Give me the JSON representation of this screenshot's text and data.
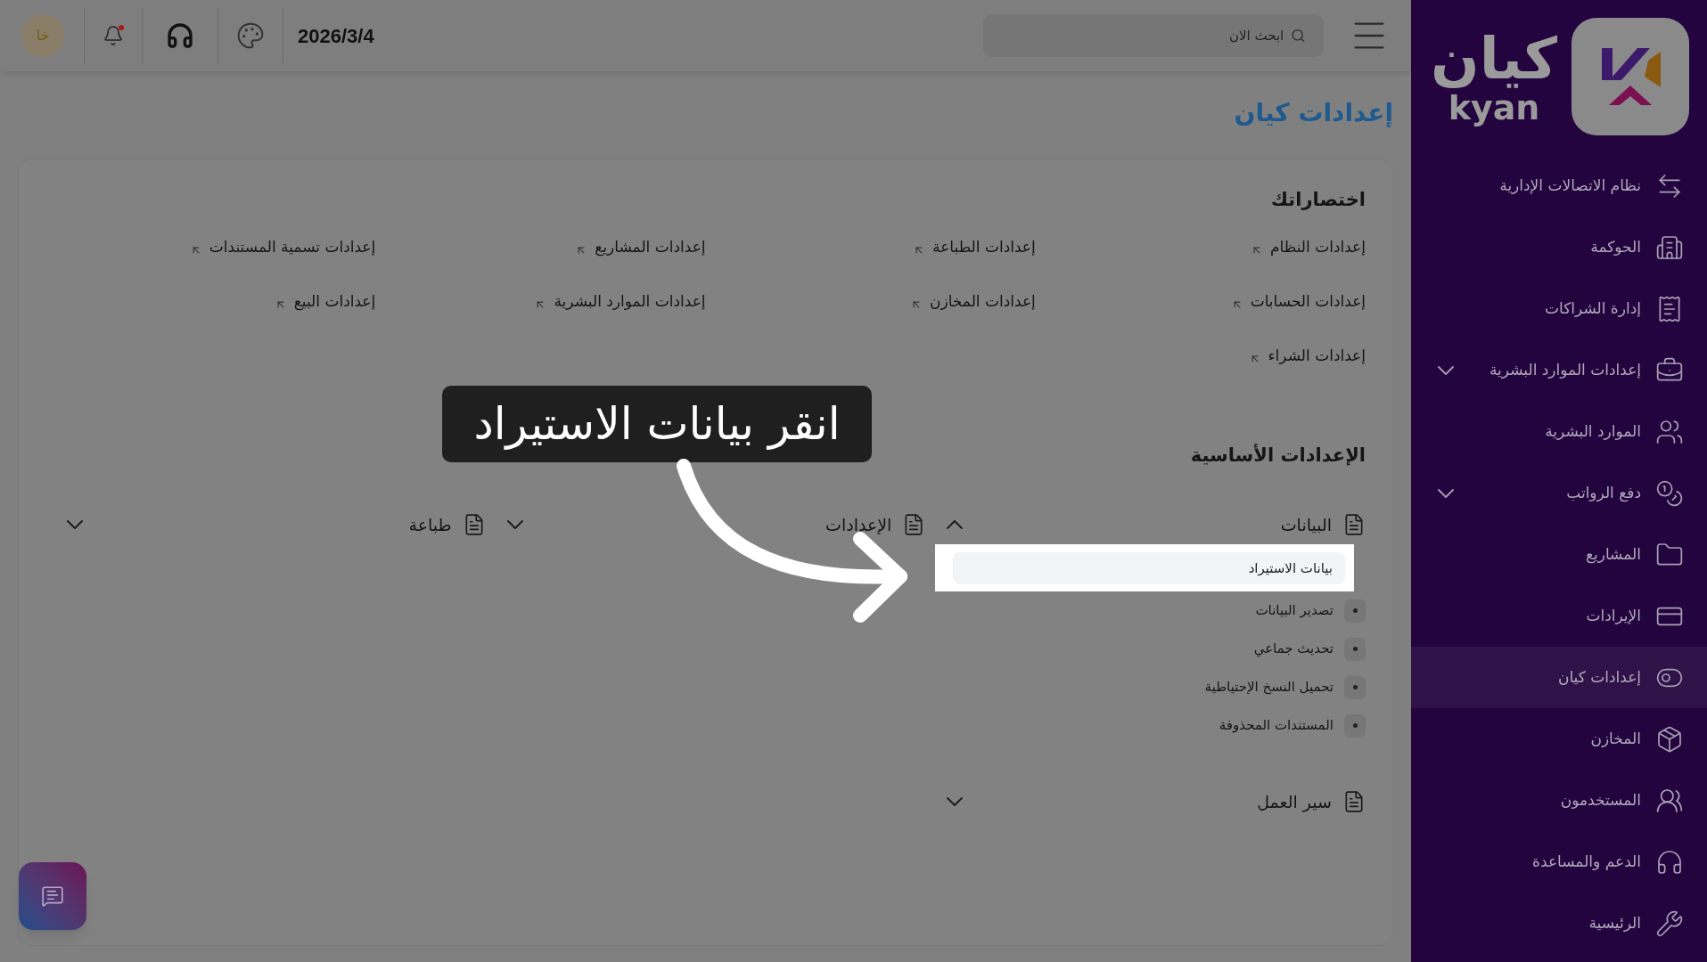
{
  "topbar": {
    "search": {
      "placeholder": "ابحث الان"
    },
    "date": "2026/3/4",
    "avatar": "خا",
    "has_unread": true
  },
  "sidebar": {
    "logo": {
      "arabic": "كيان",
      "latin": "kyan"
    },
    "items": [
      {
        "label": "نظام الاتصالات الإدارية",
        "selected": false,
        "expandable": false
      },
      {
        "label": "الحوكمة",
        "selected": false,
        "expandable": false
      },
      {
        "label": "إدارة الشراكات",
        "selected": false,
        "expandable": false
      },
      {
        "label": "إعدادات الموارد البشرية",
        "selected": false,
        "expandable": true
      },
      {
        "label": "الموارد البشرية",
        "selected": false,
        "expandable": false
      },
      {
        "label": "دفع الرواتب",
        "selected": false,
        "expandable": true
      },
      {
        "label": "المشاريع",
        "selected": false,
        "expandable": false
      },
      {
        "label": "الإيرادات",
        "selected": false,
        "expandable": false
      },
      {
        "label": "إعدادات كيان",
        "selected": true,
        "expandable": false
      },
      {
        "label": "المخازن",
        "selected": false,
        "expandable": false
      },
      {
        "label": "المستخدمون",
        "selected": false,
        "expandable": false
      },
      {
        "label": "الدعم والمساعدة",
        "selected": false,
        "expandable": false
      },
      {
        "label": "الرئيسية",
        "selected": false,
        "expandable": false
      }
    ]
  },
  "page": {
    "title": "إعدادات كيان"
  },
  "shortcuts": {
    "title": "اختصاراتك",
    "items": [
      "إعدادات النظام",
      "إعدادات الطباعة",
      "إعدادات المشاريع",
      "إعدادات تسمية المستندات",
      "إعدادات الحسابات",
      "إعدادات المخازن",
      "إعدادات الموارد البشرية",
      "إعدادات البيع",
      "إعدادات الشراء"
    ]
  },
  "basic_settings": {
    "title": "الإعدادات الأساسية",
    "sections": [
      {
        "label": "البيانات",
        "expanded": true,
        "children": [
          {
            "label": "بيانات الاستيراد",
            "highlighted": true
          },
          {
            "label": "تصدير البيانات",
            "highlighted": false
          },
          {
            "label": "تحديث جماعي",
            "highlighted": false
          },
          {
            "label": "تحميل النسخ الإحتياطية",
            "highlighted": false
          },
          {
            "label": "المستندات المحذوفة",
            "highlighted": false
          }
        ]
      },
      {
        "label": "الإعدادات",
        "expanded": false
      },
      {
        "label": "طباعة",
        "expanded": false
      },
      {
        "label": "سير العمل",
        "expanded": false
      }
    ]
  },
  "tour": {
    "text": "انقر بيانات الاستيراد"
  }
}
